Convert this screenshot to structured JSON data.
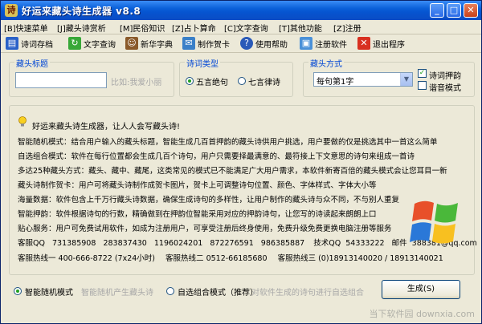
{
  "window": {
    "title": "好运来藏头诗生成器 v8.8",
    "icon_glyph": "诗",
    "controls": {
      "minimize": "_",
      "maximize": "□",
      "close": "✕"
    }
  },
  "menu": [
    "[B]快速菜单",
    "[J]藏头诗赏析",
    "[M]民俗知识",
    "[Z]占卜算命",
    "[C]文字查询",
    "[T]其他功能",
    "[Z]注册"
  ],
  "toolbar": [
    {
      "label": "诗词存档",
      "icon": "save-icon",
      "color": "#2a62c8"
    },
    {
      "label": "文字查询",
      "icon": "refresh-icon",
      "color": "#38a838"
    },
    {
      "label": "新华字典",
      "icon": "person-icon",
      "color": "#8a5a2a"
    },
    {
      "label": "制作贺卡",
      "icon": "card-icon",
      "color": "#3a80c8"
    },
    {
      "label": "使用帮助",
      "icon": "help-icon",
      "color": "#2a5ab8"
    },
    {
      "label": "注册软件",
      "icon": "disk-icon",
      "color": "#4a90d8"
    },
    {
      "label": "退出程序",
      "icon": "exit-icon",
      "color": "#d83020"
    }
  ],
  "title_group": {
    "legend": "藏头标题",
    "input_value": "",
    "hint": "比如:我爱小丽"
  },
  "poem_type": {
    "legend": "诗词类型",
    "options": [
      "五言绝句",
      "七言律诗"
    ],
    "selected": 0
  },
  "mode_group": {
    "legend": "藏头方式",
    "select_value": "每句第1字",
    "checks": [
      {
        "label": "诗词押韵",
        "checked": true
      },
      {
        "label": "谐音模式",
        "checked": false
      }
    ]
  },
  "description": {
    "intro": "好运来藏头诗生成器，让人人会写藏头诗!",
    "lines": [
      "智能随机模式：结合用户输入的藏头标题，智能生成几百首押韵的藏头诗供用户挑选，用户要做的仅是挑选其中一首这么简单",
      "自选组合模式：软件在每行位置都会生成几百个诗句，用户只需要择最满意的、最符接上下文意思的诗句来组成一首诗",
      "多达25种藏头方式：藏头、藏中、藏尾，这类常见的模式已不能满足广大用户需求，本软件新寄百倍的藏头模式会让您耳目一新",
      "藏头诗制作贺卡：用户可将藏头诗制作成贺卡图片，贺卡上可调整诗句位置、颜色、字体样式、字体大小等",
      "海量数据：软件包含上千万行藏头诗数据，确保生成诗句的多样性，让用户制作的藏头诗与众不同，不与别人重复",
      "智能押韵：软件根据诗句的行数，精确做到在押韵位智能采用对应的押韵诗句，让您写的诗读起来朗朗上口",
      "贴心服务：用户可免费试用软件，如成为注册用户，可享受注册后终身使用，免费升级免费更换电脑注册等服务"
    ],
    "contact": {
      "qq_label": "客服QQ",
      "qq": [
        "731385908",
        "283837430",
        "1196024201",
        "872276591",
        "986385887"
      ],
      "tech_qq_label": "技术QQ",
      "tech_qq": "54333222",
      "email_label": "邮件",
      "email": "388381@qq.com",
      "hotline1": "客服热线一 400-666-8722 (7x24小时)",
      "hotline2": "客服热线二 0512-66185680",
      "hotline3": "客服热线三 (0)18913140020 / 18913140021"
    }
  },
  "bottom": {
    "modes": [
      {
        "label": "智能随机模式",
        "hint": "智能随机产生藏头诗"
      },
      {
        "label": "自选组合模式（推荐）",
        "hint": "对软件生成的诗句进行自选组合"
      }
    ],
    "selected": 0,
    "generate_label": "生成(S)"
  },
  "watermark": "当下软件园 downxia.com"
}
